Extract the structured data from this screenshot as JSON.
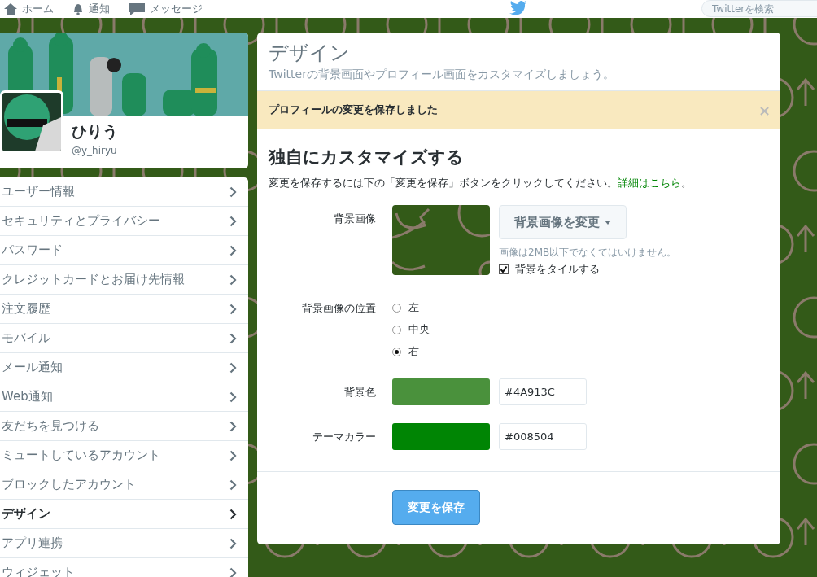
{
  "nav": {
    "items": [
      {
        "label": "ホーム",
        "kind": "home"
      },
      {
        "label": "通知",
        "kind": "bell"
      },
      {
        "label": "メッセージ",
        "kind": "mail"
      }
    ],
    "search": {
      "placeholder": "Twitterを検索"
    }
  },
  "profile": {
    "name": "ひりう",
    "handle": "@y_hiryu"
  },
  "menu": [
    {
      "label": "ユーザー情報",
      "selected": false
    },
    {
      "label": "セキュリティとプライバシー",
      "selected": false
    },
    {
      "label": "パスワード",
      "selected": false
    },
    {
      "label": "クレジットカードとお届け先情報",
      "selected": false
    },
    {
      "label": "注文履歴",
      "selected": false
    },
    {
      "label": "モバイル",
      "selected": false
    },
    {
      "label": "メール通知",
      "selected": false
    },
    {
      "label": "Web通知",
      "selected": false
    },
    {
      "label": "友だちを見つける",
      "selected": false
    },
    {
      "label": "ミュートしているアカウント",
      "selected": false
    },
    {
      "label": "ブロックしたアカウント",
      "selected": false
    },
    {
      "label": "デザイン",
      "selected": true
    },
    {
      "label": "アプリ連携",
      "selected": false
    },
    {
      "label": "ウィジェット",
      "selected": false
    }
  ],
  "panel": {
    "title": "デザイン",
    "subtitle": "Twitterの背景画面やプロフィール画面をカスタマイズしましょう。",
    "alert": {
      "text": "プロフィールの変更を保存しました",
      "close": "×"
    },
    "heading": "独自にカスタマイズする",
    "description": {
      "text": "変更を保存するには下の「変更を保存」ボタンをクリックしてください。",
      "link": "詳細はこちら",
      "after": "。"
    },
    "background_image": {
      "label": "背景画像",
      "button": "背景画像を変更",
      "note": "画像は2MB以下でなくてはいけません。",
      "tile": {
        "label": "背景をタイルする",
        "checked": true
      }
    },
    "position": {
      "label": "背景画像の位置",
      "options": [
        {
          "label": "左",
          "selected": false
        },
        {
          "label": "中央",
          "selected": false
        },
        {
          "label": "右",
          "selected": true
        }
      ]
    },
    "colors": [
      {
        "label": "背景色",
        "color": "#4a913c",
        "value": "#4A913C"
      },
      {
        "label": "テーマカラー",
        "color": "#008504",
        "value": "#008504"
      }
    ],
    "save": "変更を保存"
  }
}
